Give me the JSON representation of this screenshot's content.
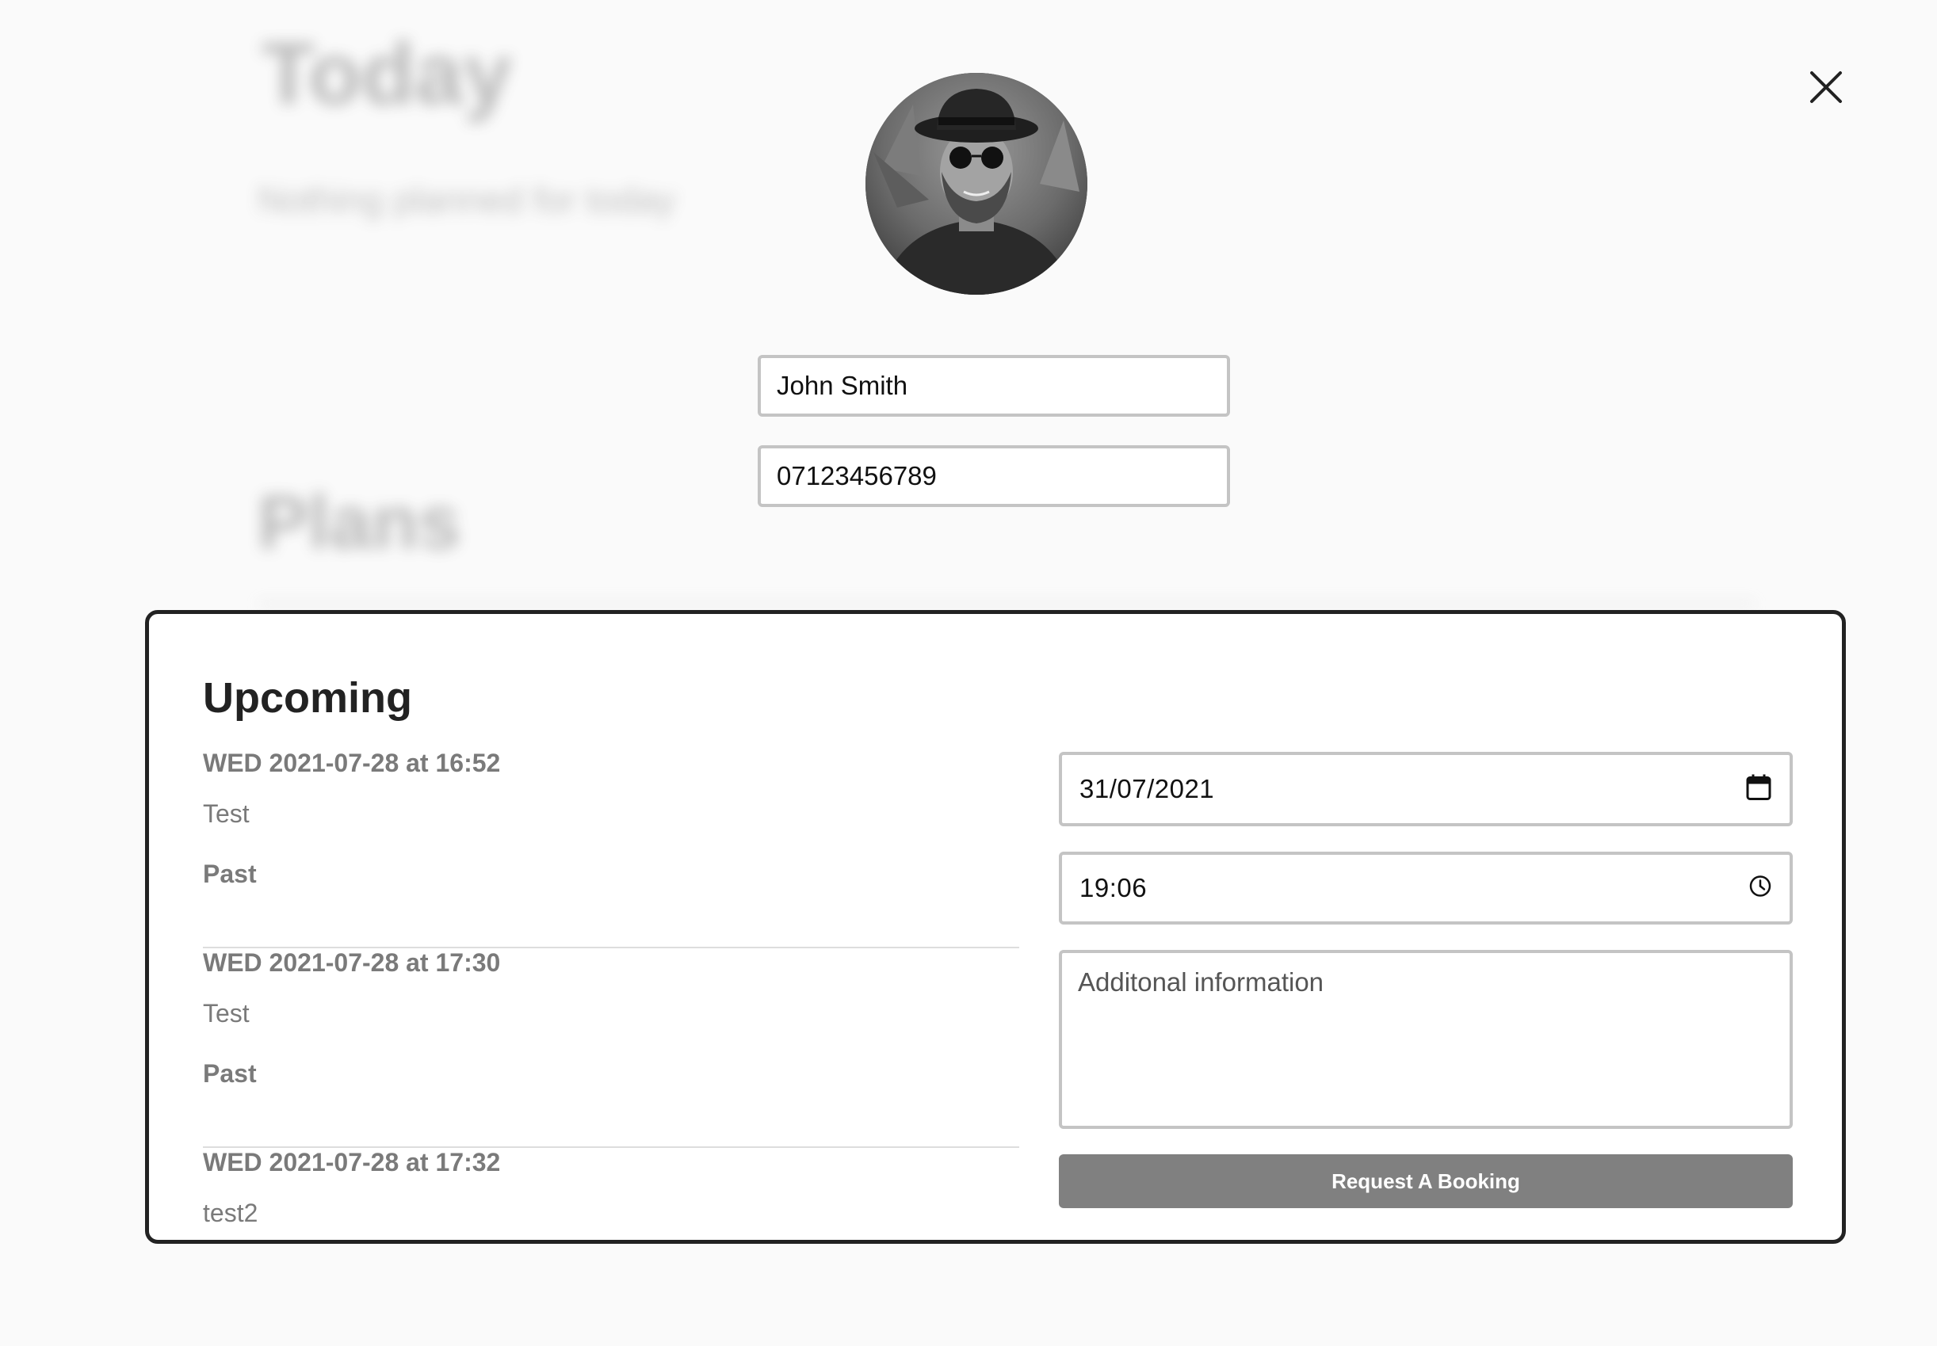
{
  "background": {
    "title": "Today",
    "subtitle": "Nothing planned for today",
    "section_heading": "Plans"
  },
  "modal": {
    "close_icon": "close-icon",
    "avatar_alt": "profile photo",
    "name_value": "John Smith",
    "phone_value": "07123456789",
    "panel_heading": "Upcoming",
    "bookings": [
      {
        "datetime": "WED 2021-07-28 at 16:52",
        "note": "Test",
        "status": "Past"
      },
      {
        "datetime": "WED 2021-07-28 at 17:30",
        "note": "Test",
        "status": "Past"
      },
      {
        "datetime": "WED 2021-07-28 at 17:32",
        "note": "test2",
        "status": ""
      }
    ],
    "form": {
      "date_value": "31/07/2021",
      "date_icon": "calendar-icon",
      "time_value": "19:06",
      "time_icon": "clock-icon",
      "info_placeholder": "Additonal information",
      "submit_label": "Request A Booking"
    }
  }
}
